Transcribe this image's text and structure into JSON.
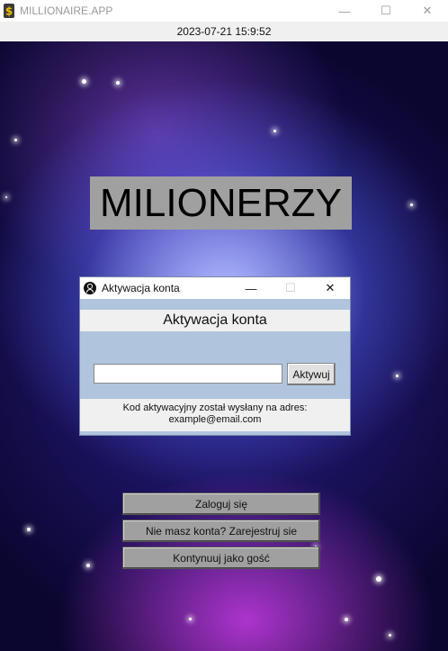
{
  "window": {
    "title": "MILLIONAIRE.APP",
    "controls": {
      "minimize": "—",
      "maximize": "☐",
      "close": "✕"
    }
  },
  "datetime": "2023-07-21 15:9:52",
  "logo": {
    "text": "MILIONERZY"
  },
  "dialog": {
    "title": "Aktywacja konta",
    "controls": {
      "minimize": "—",
      "maximize": "☐",
      "close": "✕"
    },
    "heading": "Aktywacja konta",
    "input": {
      "value": "",
      "placeholder": ""
    },
    "activate_label": "Aktywuj",
    "info_line1": "Kod aktywacyjny został wysłany na adres:",
    "info_line2": "example@email.com"
  },
  "menu": {
    "login_label": "Zaloguj się",
    "register_label": "Nie masz konta? Zarejestruj sie",
    "guest_label": "Kontynuuj jako gość"
  },
  "colors": {
    "logo_bg": "#a0a0a0",
    "dialog_bg": "#b0c4de",
    "button_bg": "#a0a0a0"
  },
  "icons": {
    "app": "dollar-sign-icon",
    "dialog": "user-circle-icon"
  }
}
